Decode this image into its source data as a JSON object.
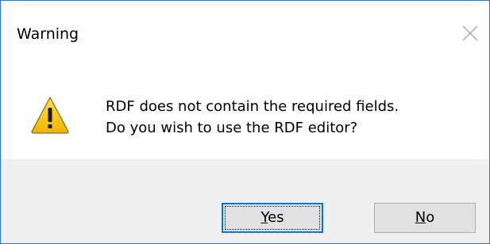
{
  "dialog": {
    "title": "Warning",
    "close_icon": "close-icon",
    "icon": "warning-triangle-icon",
    "message_lines": [
      "RDF does not contain the required fields.",
      "Do you wish to use the RDF editor?"
    ]
  },
  "buttons": {
    "yes": {
      "mnemonic": "Y",
      "rest": "es"
    },
    "no": {
      "mnemonic": "N",
      "rest": "o"
    }
  },
  "colors": {
    "border": "#2a7bd0",
    "footer_bg": "#f0f0f0",
    "button_bg": "#e1e1e1",
    "focus_border": "#0078d7",
    "warning_yellow": "#f5c400"
  }
}
